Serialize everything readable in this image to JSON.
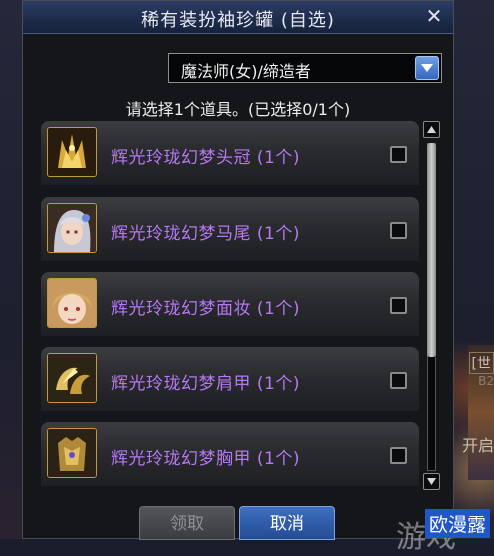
{
  "dialog": {
    "title": "稀有装扮袖珍罐 (自选)",
    "close_glyph": "✕",
    "class_select_value": "魔法师(女)/缔造者",
    "prompt": "请选择1个道具。(已选择0/1个)"
  },
  "items": [
    {
      "name": "辉光玲珑幻梦头冠 (1个)",
      "icon": "crown-icon",
      "checked": false
    },
    {
      "name": "辉光玲珑幻梦马尾 (1个)",
      "icon": "ponytail-avatar-icon",
      "checked": false
    },
    {
      "name": "辉光玲珑幻梦面妆 (1个)",
      "icon": "face-makeup-avatar-icon",
      "checked": false
    },
    {
      "name": "辉光玲珑幻梦肩甲 (1个)",
      "icon": "shoulder-armor-icon",
      "checked": false
    },
    {
      "name": "辉光玲珑幻梦胸甲 (1个)",
      "icon": "chest-armor-icon",
      "checked": false
    }
  ],
  "buttons": {
    "receive_label": "领取",
    "cancel_label": "取消",
    "receive_enabled": false
  },
  "background_text": {
    "top_fragment": "[世",
    "middle_fragment": "B2",
    "lower_fragment": "开启"
  },
  "watermark": {
    "big_text": "游戏",
    "badge_text": "欧漫露"
  },
  "colors": {
    "title_bar": "#1e2d4d",
    "item_name": "#b678f2",
    "cancel_button": "#2f5fae",
    "icon_border": "#c39a3a"
  }
}
